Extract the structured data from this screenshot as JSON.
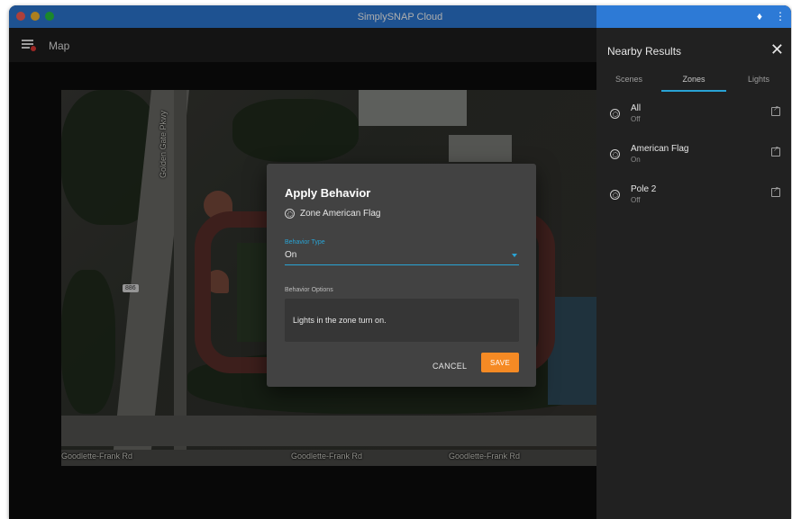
{
  "window": {
    "title": "SimplySNAP Cloud"
  },
  "titlebar": {
    "extensions_icon": "puzzle-icon",
    "more_icon": "more-vert-icon"
  },
  "appbar": {
    "title": "Map",
    "menu_icon": "menu-icon"
  },
  "map": {
    "labels": {
      "road_vertical": "Golden Gate Pkwy",
      "road_bottom_left": "Goodlette-Frank Rd",
      "road_bottom_mid": "Goodlette-Frank Rd",
      "road_bottom_right": "Goodlette-Frank Rd",
      "route_shield": "886"
    }
  },
  "side_panel": {
    "title": "Nearby Results",
    "tabs": [
      {
        "label": "Scenes",
        "active": false
      },
      {
        "label": "Zones",
        "active": true
      },
      {
        "label": "Lights",
        "active": false
      }
    ],
    "zones": [
      {
        "name": "All",
        "state": "Off"
      },
      {
        "name": "American Flag",
        "state": "On"
      },
      {
        "name": "Pole 2",
        "state": "Off"
      }
    ]
  },
  "dialog": {
    "title": "Apply Behavior",
    "zone_label": "Zone American Flag",
    "behavior_type_label": "Behavior Type",
    "behavior_type_value": "On",
    "behavior_options_label": "Behavior Options",
    "behavior_description": "Lights in the zone turn on.",
    "cancel_label": "CANCEL",
    "save_label": "SAVE"
  },
  "colors": {
    "titlebar": "#2d7ad6",
    "accent": "#29a3d4",
    "save_button": "#f58a24",
    "panel": "#212121",
    "dialog": "#424242"
  }
}
